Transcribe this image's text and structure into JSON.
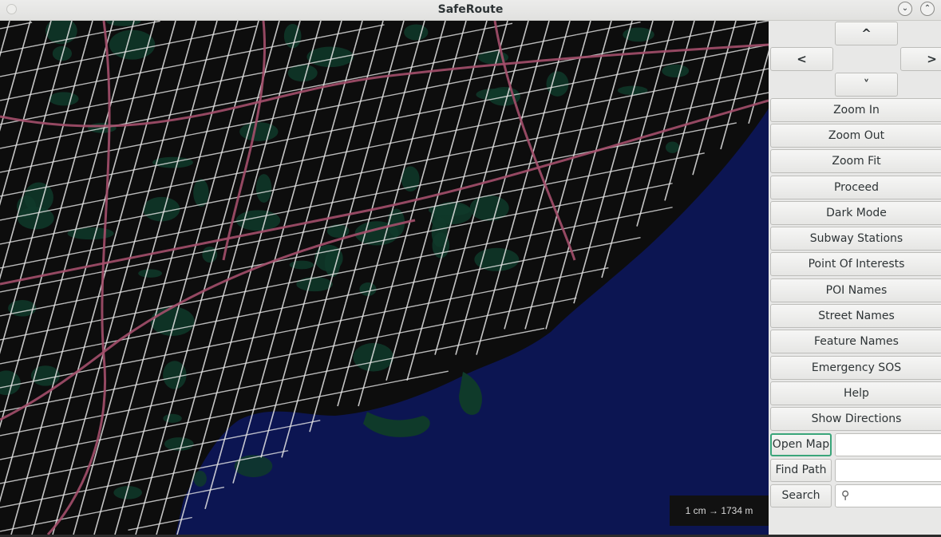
{
  "window": {
    "title": "SafeRoute",
    "minimize_icon": "chevron-down-circle-icon",
    "maximize_icon": "chevron-up-circle-icon"
  },
  "map": {
    "scale_label": "1 cm → 1734 m",
    "colors": {
      "land": "#0d0d0d",
      "water": "#0c1552",
      "green": "#0f3a2a",
      "street": "#e6e6e6",
      "highway": "#a44f6c"
    }
  },
  "nav": {
    "up": "^",
    "left": "<",
    "right": ">",
    "down": "˅"
  },
  "buttons": [
    {
      "label": "Zoom In"
    },
    {
      "label": "Zoom Out"
    },
    {
      "label": "Zoom Fit"
    },
    {
      "label": "Proceed"
    },
    {
      "label": "Dark Mode"
    },
    {
      "label": "Subway Stations"
    },
    {
      "label": "Point Of Interests"
    },
    {
      "label": "POI Names"
    },
    {
      "label": "Street Names"
    },
    {
      "label": "Feature Names"
    },
    {
      "label": "Emergency SOS"
    },
    {
      "label": "Help"
    },
    {
      "label": "Show Directions"
    }
  ],
  "fields": {
    "open_map": {
      "label": "Open Map",
      "value": ""
    },
    "find_path": {
      "label": "Find Path",
      "value": ""
    },
    "search": {
      "label": "Search",
      "value": "",
      "icon": "search-icon"
    }
  }
}
